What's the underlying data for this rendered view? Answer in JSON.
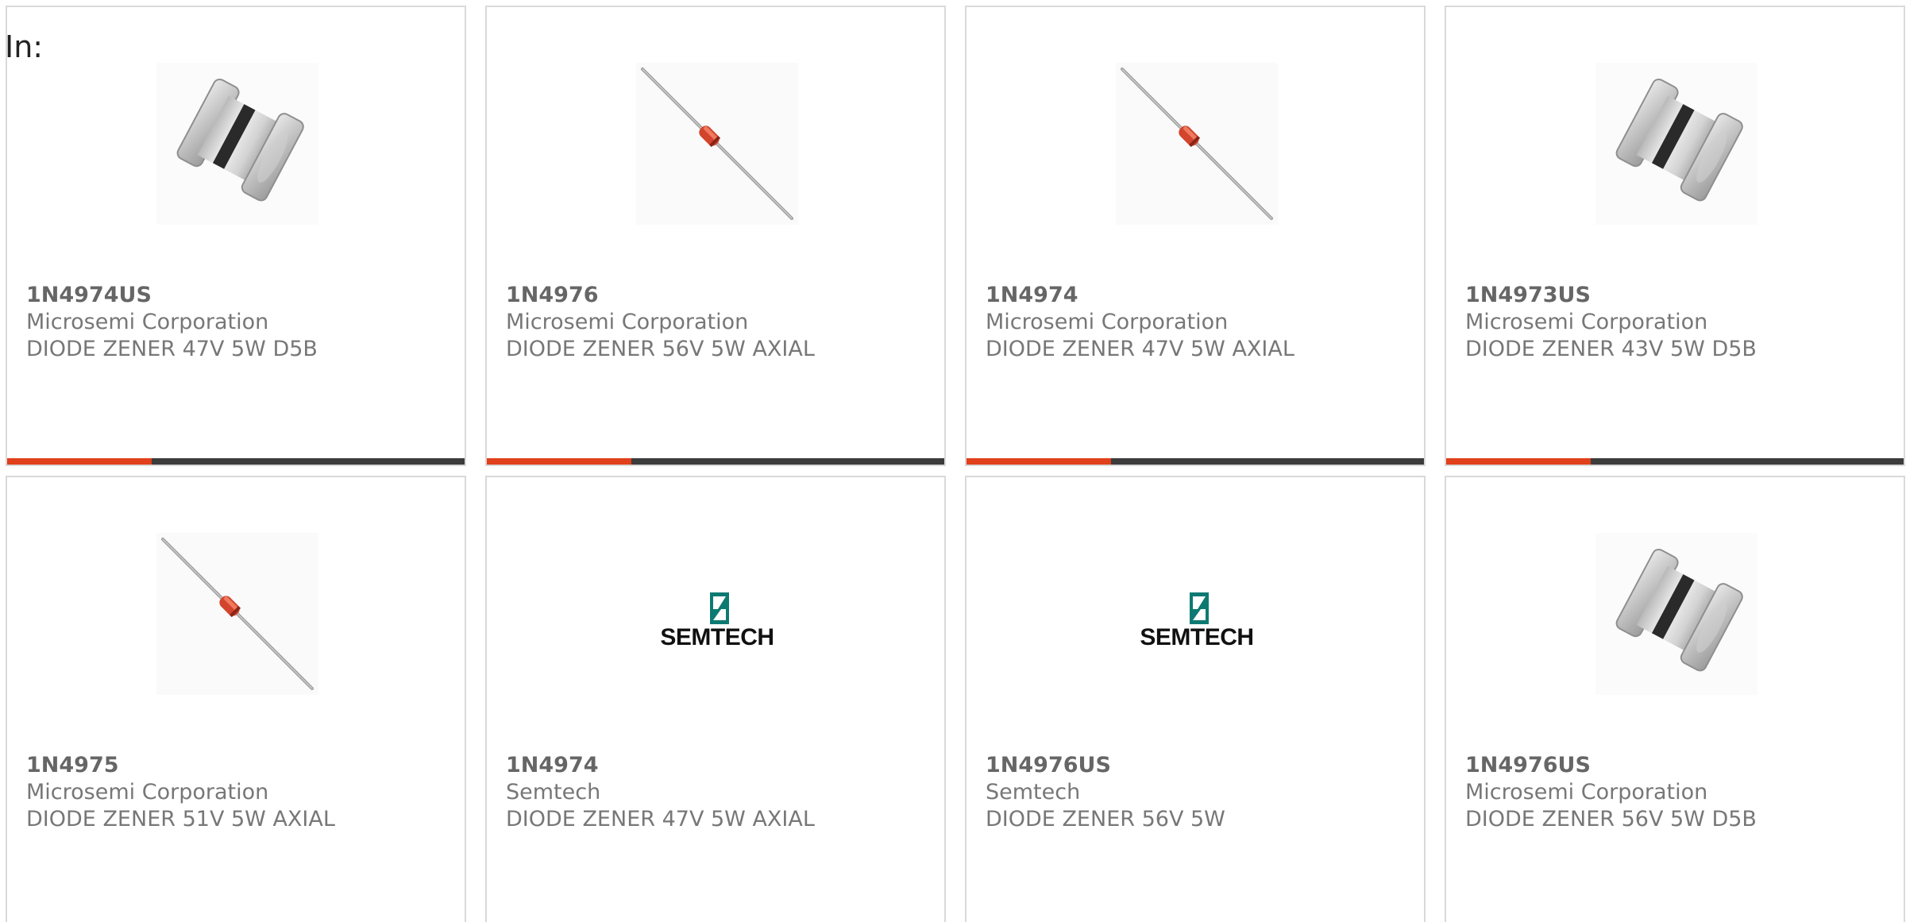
{
  "filter_label": "In:",
  "colors": {
    "accent": "#e0401a",
    "bar": "#3c3c3c",
    "card_border": "#d9d9d9",
    "text": "#777777"
  },
  "products": [
    {
      "part": "1N4974US",
      "maker": "Microsemi Corporation",
      "desc": "DIODE ZENER 47V 5W D5B",
      "image": "d5b-package-icon"
    },
    {
      "part": "1N4976",
      "maker": "Microsemi Corporation",
      "desc": "DIODE ZENER 56V 5W AXIAL",
      "image": "axial-diode-icon"
    },
    {
      "part": "1N4974",
      "maker": "Microsemi Corporation",
      "desc": "DIODE ZENER 47V 5W AXIAL",
      "image": "axial-diode-icon"
    },
    {
      "part": "1N4973US",
      "maker": "Microsemi Corporation",
      "desc": "DIODE ZENER 43V 5W D5B",
      "image": "d5b-package-icon"
    },
    {
      "part": "1N4975",
      "maker": "Microsemi Corporation",
      "desc": "DIODE ZENER 51V 5W AXIAL",
      "image": "axial-diode-icon"
    },
    {
      "part": "1N4974",
      "maker": "Semtech",
      "desc": "DIODE ZENER 47V 5W AXIAL",
      "image": "semtech-logo",
      "logo_text": "SEMTECH"
    },
    {
      "part": "1N4976US",
      "maker": "Semtech",
      "desc": "DIODE ZENER 56V 5W",
      "image": "semtech-logo",
      "logo_text": "SEMTECH"
    },
    {
      "part": "1N4976US",
      "maker": "Microsemi Corporation",
      "desc": "DIODE ZENER 56V 5W D5B",
      "image": "d5b-package-icon"
    }
  ]
}
